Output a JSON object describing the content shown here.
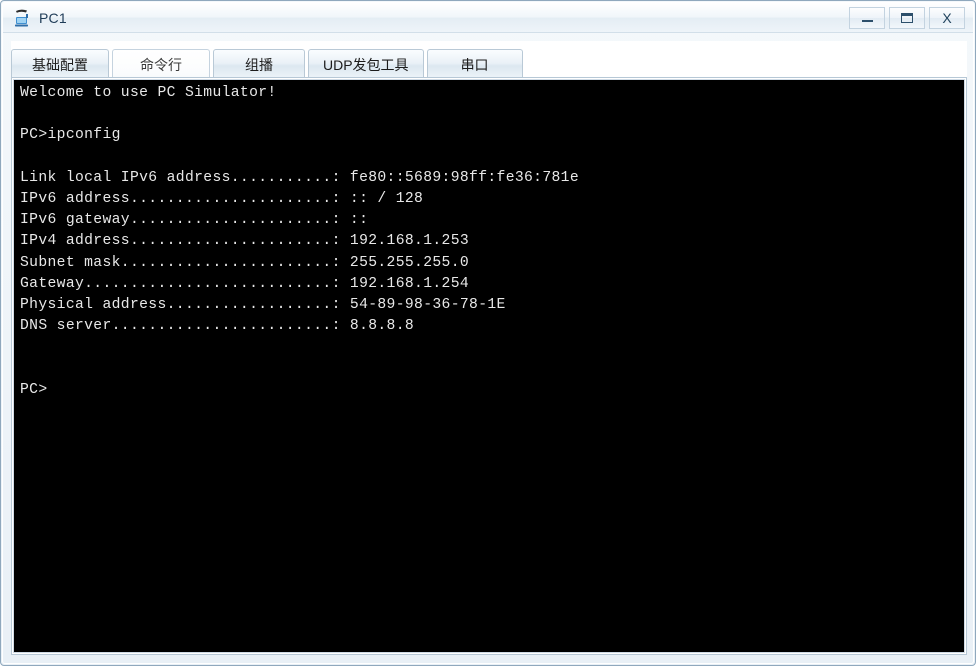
{
  "window": {
    "title": "PC1",
    "icon": "pc-device-icon",
    "controls": {
      "minimize_label": "–",
      "maximize_label": "□",
      "close_label": "X",
      "minimize_name": "minimize",
      "maximize_name": "maximize",
      "close_name": "close"
    }
  },
  "tabs": [
    {
      "label": "基础配置",
      "active": false
    },
    {
      "label": "命令行",
      "active": true
    },
    {
      "label": "组播",
      "active": false
    },
    {
      "label": "UDP发包工具",
      "active": false
    },
    {
      "label": "串口",
      "active": false
    }
  ],
  "terminal": {
    "background": "#000000",
    "foreground": "#e8e8e8",
    "lines": [
      "Welcome to use PC Simulator!",
      "",
      "PC>ipconfig",
      "",
      "Link local IPv6 address...........: fe80::5689:98ff:fe36:781e",
      "IPv6 address......................: :: / 128",
      "IPv6 gateway......................: ::",
      "IPv4 address......................: 192.168.1.253",
      "Subnet mask.......................: 255.255.255.0",
      "Gateway...........................: 192.168.1.254",
      "Physical address..................: 54-89-98-36-78-1E",
      "DNS server........................: 8.8.8.8",
      "",
      "",
      "PC>"
    ],
    "command_entered": "ipconfig",
    "prompt": "PC>",
    "values": {
      "link_local_ipv6_address": "fe80::5689:98ff:fe36:781e",
      "ipv6_address": ":: / 128",
      "ipv6_gateway": "::",
      "ipv4_address": "192.168.1.253",
      "subnet_mask": "255.255.255.0",
      "gateway": "192.168.1.254",
      "physical_address": "54-89-98-36-78-1E",
      "dns_server": "8.8.8.8"
    }
  }
}
